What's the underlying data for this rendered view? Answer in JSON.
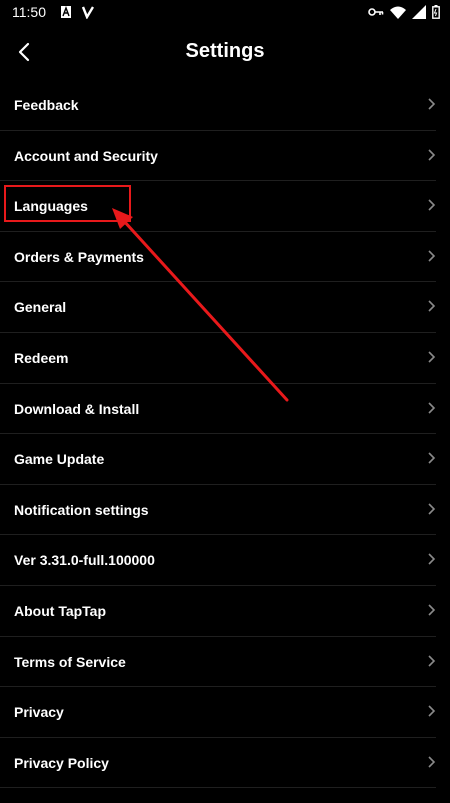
{
  "status_bar": {
    "time": "11:50",
    "icons": [
      "notification-a-icon",
      "notification-check-icon",
      "vpn-key-icon",
      "wifi-icon",
      "signal-icon",
      "battery-icon"
    ]
  },
  "header": {
    "back_icon": "chevron-left-icon",
    "title": "Settings"
  },
  "settings": {
    "items": [
      {
        "label": "Feedback"
      },
      {
        "label": "Account and Security"
      },
      {
        "label": "Languages"
      },
      {
        "label": "Orders & Payments"
      },
      {
        "label": "General"
      },
      {
        "label": "Redeem"
      },
      {
        "label": "Download & Install"
      },
      {
        "label": "Game Update"
      },
      {
        "label": "Notification settings"
      },
      {
        "label": "Ver 3.31.0-full.100000"
      },
      {
        "label": "About TapTap"
      },
      {
        "label": "Terms of Service"
      },
      {
        "label": "Privacy"
      },
      {
        "label": "Privacy Policy"
      }
    ]
  },
  "annotation": {
    "highlight_color": "#e8191b",
    "highlighted_item": "Languages"
  },
  "colors": {
    "background": "#000000",
    "text": "#ffffff",
    "chevron": "#8a8a8a",
    "divider": "#1f1f1f"
  }
}
